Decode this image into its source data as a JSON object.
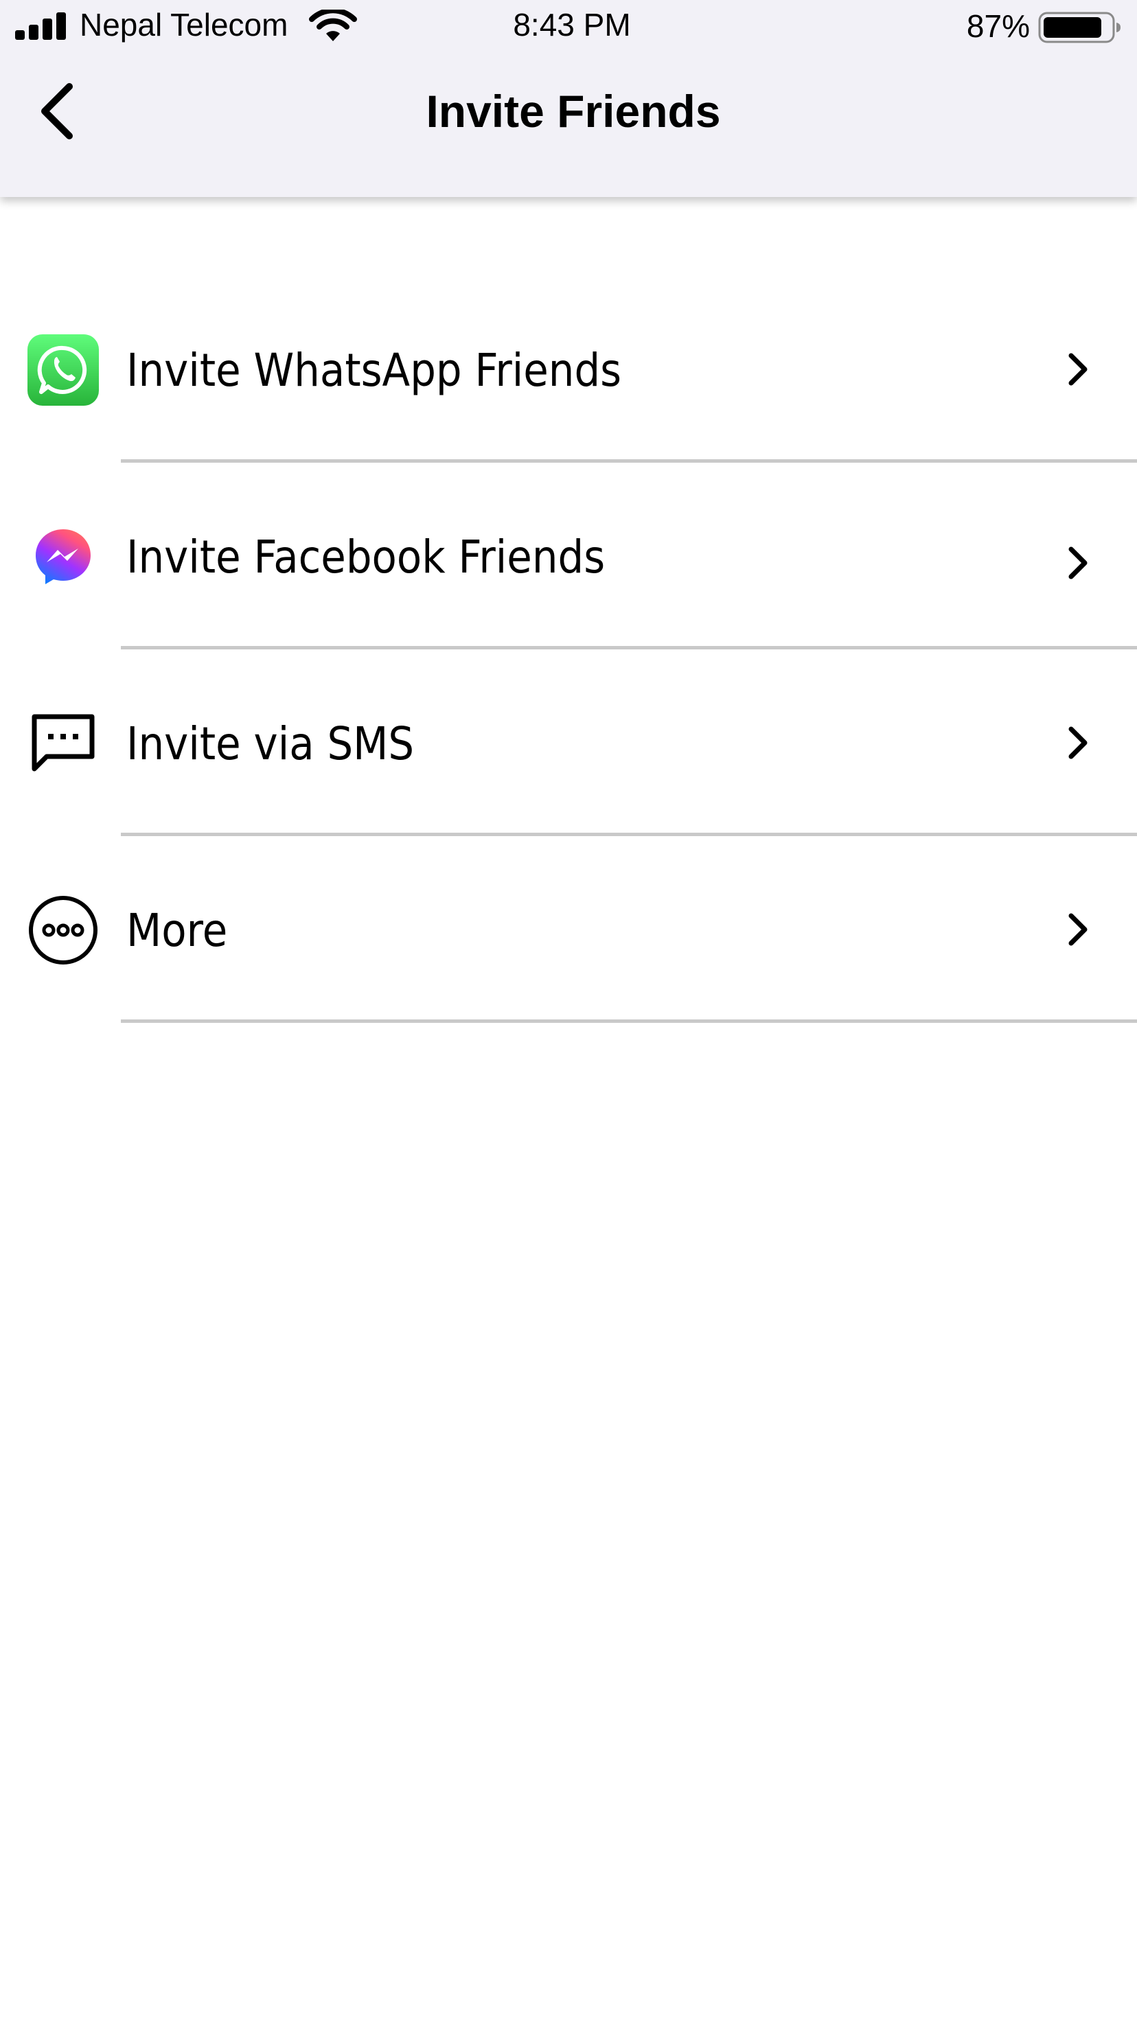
{
  "status_bar": {
    "carrier": "Nepal Telecom",
    "time": "8:43 PM",
    "battery_percent": "87%",
    "battery_level": 0.87,
    "signal_bars": 4,
    "icons": [
      "signal-icon",
      "wifi-icon",
      "battery-icon"
    ]
  },
  "nav": {
    "title": "Invite Friends",
    "back_icon": "chevron-left-icon"
  },
  "list": {
    "items": [
      {
        "label": "Invite WhatsApp Friends",
        "icon": "whatsapp-icon",
        "accent": "#25D366"
      },
      {
        "label": "Invite Facebook Friends",
        "icon": "messenger-icon",
        "accent": "#A033FF"
      },
      {
        "label": "Invite via SMS",
        "icon": "message-icon",
        "accent": "#000000"
      },
      {
        "label": "More",
        "icon": "more-icon",
        "accent": "#000000"
      }
    ],
    "chevron_icon": "chevron-right-icon"
  },
  "colors": {
    "nav_background": "#F2F1F7",
    "divider": "#C9C9C9",
    "background": "#FFFFFF"
  }
}
